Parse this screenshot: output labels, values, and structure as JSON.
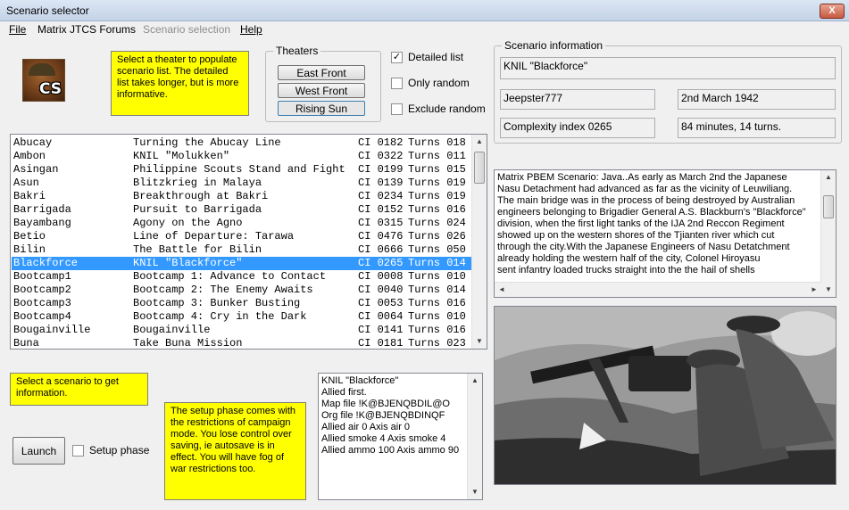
{
  "window": {
    "title": "Scenario selector",
    "close_label": "X"
  },
  "menu": {
    "items": [
      {
        "label": "File",
        "enabled": true
      },
      {
        "label": "Matrix JTCS Forums",
        "enabled": true
      },
      {
        "label": "Scenario selection",
        "enabled": false
      },
      {
        "label": "Help",
        "enabled": true
      }
    ]
  },
  "logo": {
    "text": "CS"
  },
  "theater_note": "Select a theater to populate scenario list. The detailed list takes longer, but is more informative.",
  "theaters": {
    "label": "Theaters",
    "buttons": [
      {
        "label": "East Front",
        "pressed": false
      },
      {
        "label": "West Front",
        "pressed": false
      },
      {
        "label": "Rising Sun",
        "pressed": true
      }
    ]
  },
  "options": {
    "detailed_list": {
      "label": "Detailed list",
      "checked": true,
      "mark": "✓"
    },
    "only_random": {
      "label": "Only random",
      "checked": false
    },
    "exclude_random": {
      "label": "Exclude random",
      "checked": false
    }
  },
  "scenario_info": {
    "label": "Scenario information",
    "name": "KNIL \"Blackforce\"",
    "author": "Jeepster777",
    "date": "2nd March 1942",
    "complexity": "Complexity index 0265",
    "duration": "84 minutes, 14 turns."
  },
  "scenario_list": {
    "selected_index": 9,
    "rows": [
      {
        "name": "Abucay",
        "title": "Turning the Abucay Line",
        "ci": "CI 0182",
        "turns": "Turns 018"
      },
      {
        "name": "Ambon",
        "title": "KNIL \"Molukken\"",
        "ci": "CI 0322",
        "turns": "Turns 011"
      },
      {
        "name": "Asingan",
        "title": "Philippine Scouts Stand and Fight",
        "ci": "CI 0199",
        "turns": "Turns 015"
      },
      {
        "name": "Asun",
        "title": "Blitzkrieg in Malaya",
        "ci": "CI 0139",
        "turns": "Turns 019"
      },
      {
        "name": "Bakri",
        "title": "Breakthrough at Bakri",
        "ci": "CI 0234",
        "turns": "Turns 019"
      },
      {
        "name": "Barrigada",
        "title": "Pursuit to Barrigada",
        "ci": "CI 0152",
        "turns": "Turns 016"
      },
      {
        "name": "Bayambang",
        "title": "Agony on the Agno",
        "ci": "CI 0315",
        "turns": "Turns 024"
      },
      {
        "name": "Betio",
        "title": "Line of Departure: Tarawa",
        "ci": "CI 0476",
        "turns": "Turns 026"
      },
      {
        "name": "Bilin",
        "title": "The Battle for Bilin",
        "ci": "CI 0666",
        "turns": "Turns 050"
      },
      {
        "name": "Blackforce",
        "title": "KNIL \"Blackforce\"",
        "ci": "CI 0265",
        "turns": "Turns 014"
      },
      {
        "name": "Bootcamp1",
        "title": "Bootcamp 1: Advance to Contact",
        "ci": "CI 0008",
        "turns": "Turns 010"
      },
      {
        "name": "Bootcamp2",
        "title": "Bootcamp 2: The Enemy Awaits",
        "ci": "CI 0040",
        "turns": "Turns 014"
      },
      {
        "name": "Bootcamp3",
        "title": "Bootcamp 3: Bunker Busting",
        "ci": "CI 0053",
        "turns": "Turns 016"
      },
      {
        "name": "Bootcamp4",
        "title": "Bootcamp 4: Cry in the Dark",
        "ci": "CI 0064",
        "turns": "Turns 010"
      },
      {
        "name": "Bougainville",
        "title": "Bougainville",
        "ci": "CI 0141",
        "turns": "Turns 016"
      },
      {
        "name": "Buna",
        "title": "Take Buna Mission",
        "ci": "CI 0181",
        "turns": "Turns 023"
      }
    ]
  },
  "description": {
    "lines": [
      "Matrix PBEM Scenario: Java..As early as March 2nd the Japanese",
      "Nasu Detachment had advanced as far as the vicinity of Leuwiliang.",
      "The main bridge was in the process of being destroyed by Australian",
      "engineers belonging to Brigadier General A.S. Blackburn's \"Blackforce\"",
      "division, when the first light tanks of the IJA 2nd Reccon Regiment",
      "showed up on the western shores of the Tjianten river which cut",
      "through the city.With the Japanese Engineers of Nasu Detatchment",
      "already holding the western half of the city, Colonel Hiroyasu",
      "sent infantry loaded trucks straight into the the hail of shells"
    ]
  },
  "select_note": "Select a scenario to get information.",
  "setup_note": "The setup phase comes with the restrictions of campaign mode.  You lose control over saving, ie autosave is in effect.  You will have fog of war restrictions too.",
  "launch_label": "Launch",
  "setup_phase": {
    "label": "Setup phase",
    "checked": false
  },
  "details": {
    "lines": [
      "KNIL \"Blackforce\"",
      "Allied first.",
      "Map file !K@BJENQBDIL@O",
      "Org file !K@BJENQBDINQF",
      "Allied air 0 Axis air 0",
      "Allied smoke 4 Axis smoke 4",
      "Allied ammo 100 Axis ammo 90"
    ]
  },
  "icons": {
    "up": "▲",
    "down": "▼",
    "left": "◄",
    "right": "►"
  }
}
